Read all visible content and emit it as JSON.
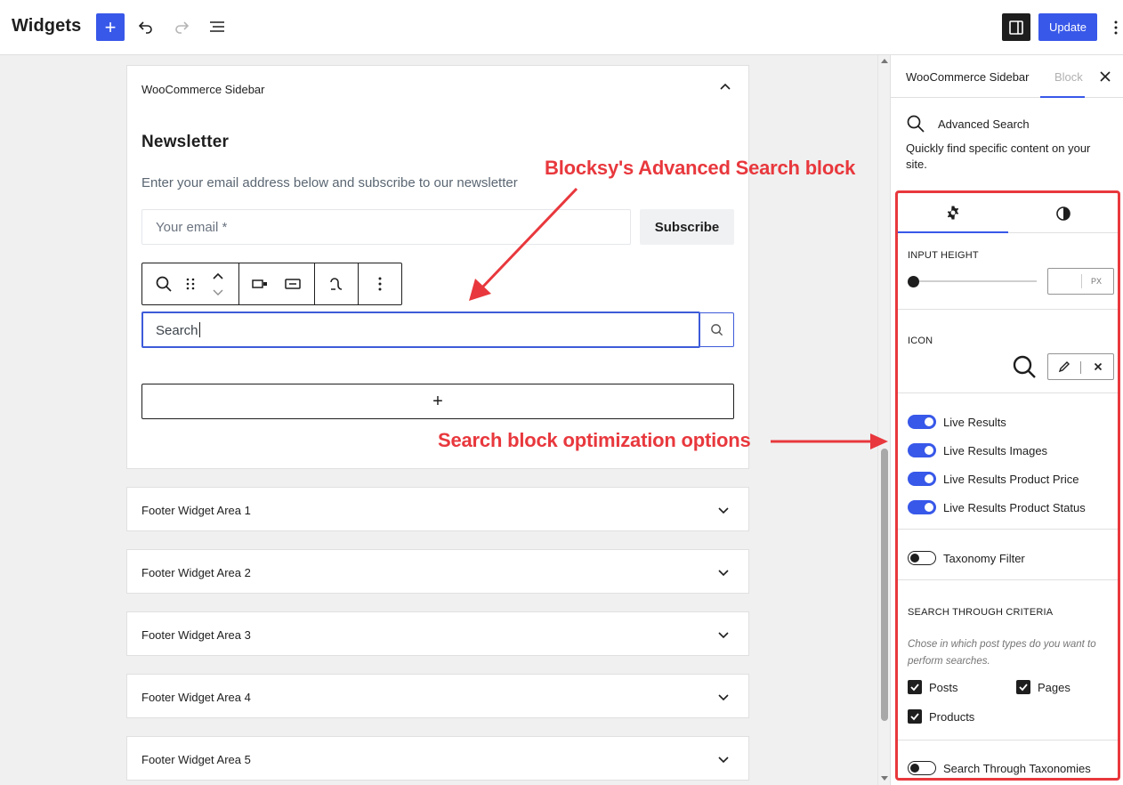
{
  "header": {
    "title": "Widgets",
    "add_icon": "plus-icon",
    "update_label": "Update"
  },
  "editor": {
    "open_area": {
      "title": "WooCommerce Sidebar",
      "newsletter_title": "Newsletter",
      "newsletter_desc": "Enter your email address below and subscribe to our newsletter",
      "email_placeholder": "Your email *",
      "subscribe_label": "Subscribe",
      "search_value": "Search"
    },
    "closed_areas": [
      {
        "label": "Footer Widget Area 1"
      },
      {
        "label": "Footer Widget Area 2"
      },
      {
        "label": "Footer Widget Area 3"
      },
      {
        "label": "Footer Widget Area 4"
      },
      {
        "label": "Footer Widget Area 5"
      }
    ]
  },
  "annotations": {
    "top": "Blocksy's Advanced Search block",
    "middle": "Search block optimization options",
    "color": "#e8383d"
  },
  "sidebar": {
    "tab_area": "WooCommerce Sidebar",
    "tab_block": "Block",
    "block_name": "Advanced Search",
    "block_desc": "Quickly find specific content on your site.",
    "input_height_label": "INPUT HEIGHT",
    "input_height_unit": "PX",
    "icon_label": "ICON",
    "toggles": [
      {
        "label": "Live Results",
        "on": true
      },
      {
        "label": "Live Results Images",
        "on": true
      },
      {
        "label": "Live Results Product Price",
        "on": true
      },
      {
        "label": "Live Results Product Status",
        "on": true
      }
    ],
    "taxonomy_filter": {
      "label": "Taxonomy Filter",
      "on": false
    },
    "criteria_label": "SEARCH THROUGH CRITERIA",
    "criteria_help": "Chose in which post types do you want to perform searches.",
    "checkboxes": [
      {
        "label": "Posts",
        "checked": true
      },
      {
        "label": "Pages",
        "checked": true
      },
      {
        "label": "Products",
        "checked": true
      }
    ],
    "taxonomies_toggle": {
      "label": "Search Through Taxonomies",
      "on": false
    }
  },
  "colors": {
    "accent": "#3858e9",
    "annotation": "#e8383d"
  }
}
